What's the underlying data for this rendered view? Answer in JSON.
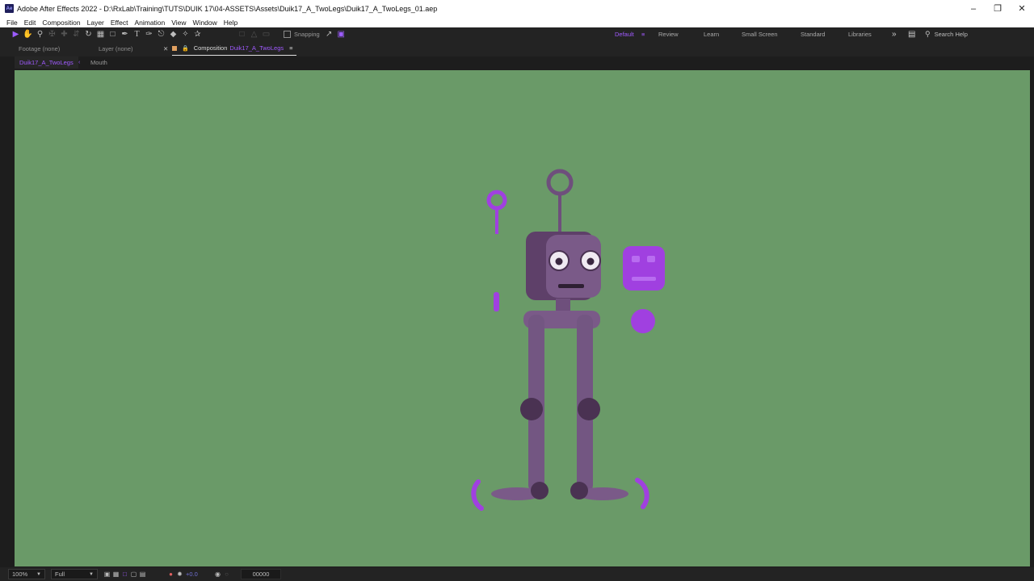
{
  "window": {
    "title": "Adobe After Effects 2022 - D:\\RxLab\\Training\\TUTS\\DUIK 17\\04-ASSETS\\Assets\\Duik17_A_TwoLegs\\Duik17_A_TwoLegs_01.aep",
    "app_badge": "Ae",
    "minimize": "–",
    "maximize": "❐",
    "close": "✕"
  },
  "menu": [
    "File",
    "Edit",
    "Composition",
    "Layer",
    "Effect",
    "Animation",
    "View",
    "Window",
    "Help"
  ],
  "toolbar": {
    "snapping_label": "Snapping",
    "workspaces": [
      "Default",
      "Review",
      "Learn",
      "Small Screen",
      "Standard",
      "Libraries"
    ],
    "active_workspace": "Default",
    "more": "»",
    "search_placeholder": "Search Help"
  },
  "panels": {
    "footage_tab": "Footage (none)",
    "layer_tab": "Layer (none)",
    "composition_prefix": "Composition",
    "composition_name": "Duik17_A_TwoLegs",
    "menu_icon": "≡"
  },
  "breadcrumbs": [
    "Duik17_A_TwoLegs",
    "Mouth"
  ],
  "statusbar": {
    "zoom": "100%",
    "resolution": "Full",
    "exposure": "+0.0",
    "timecode": "00000"
  },
  "colors": {
    "accent": "#a05aff",
    "canvas": "#6a9a68",
    "robot": "#6e4f7c",
    "robot_dark": "#4a3252",
    "controller": "#a040e0"
  }
}
